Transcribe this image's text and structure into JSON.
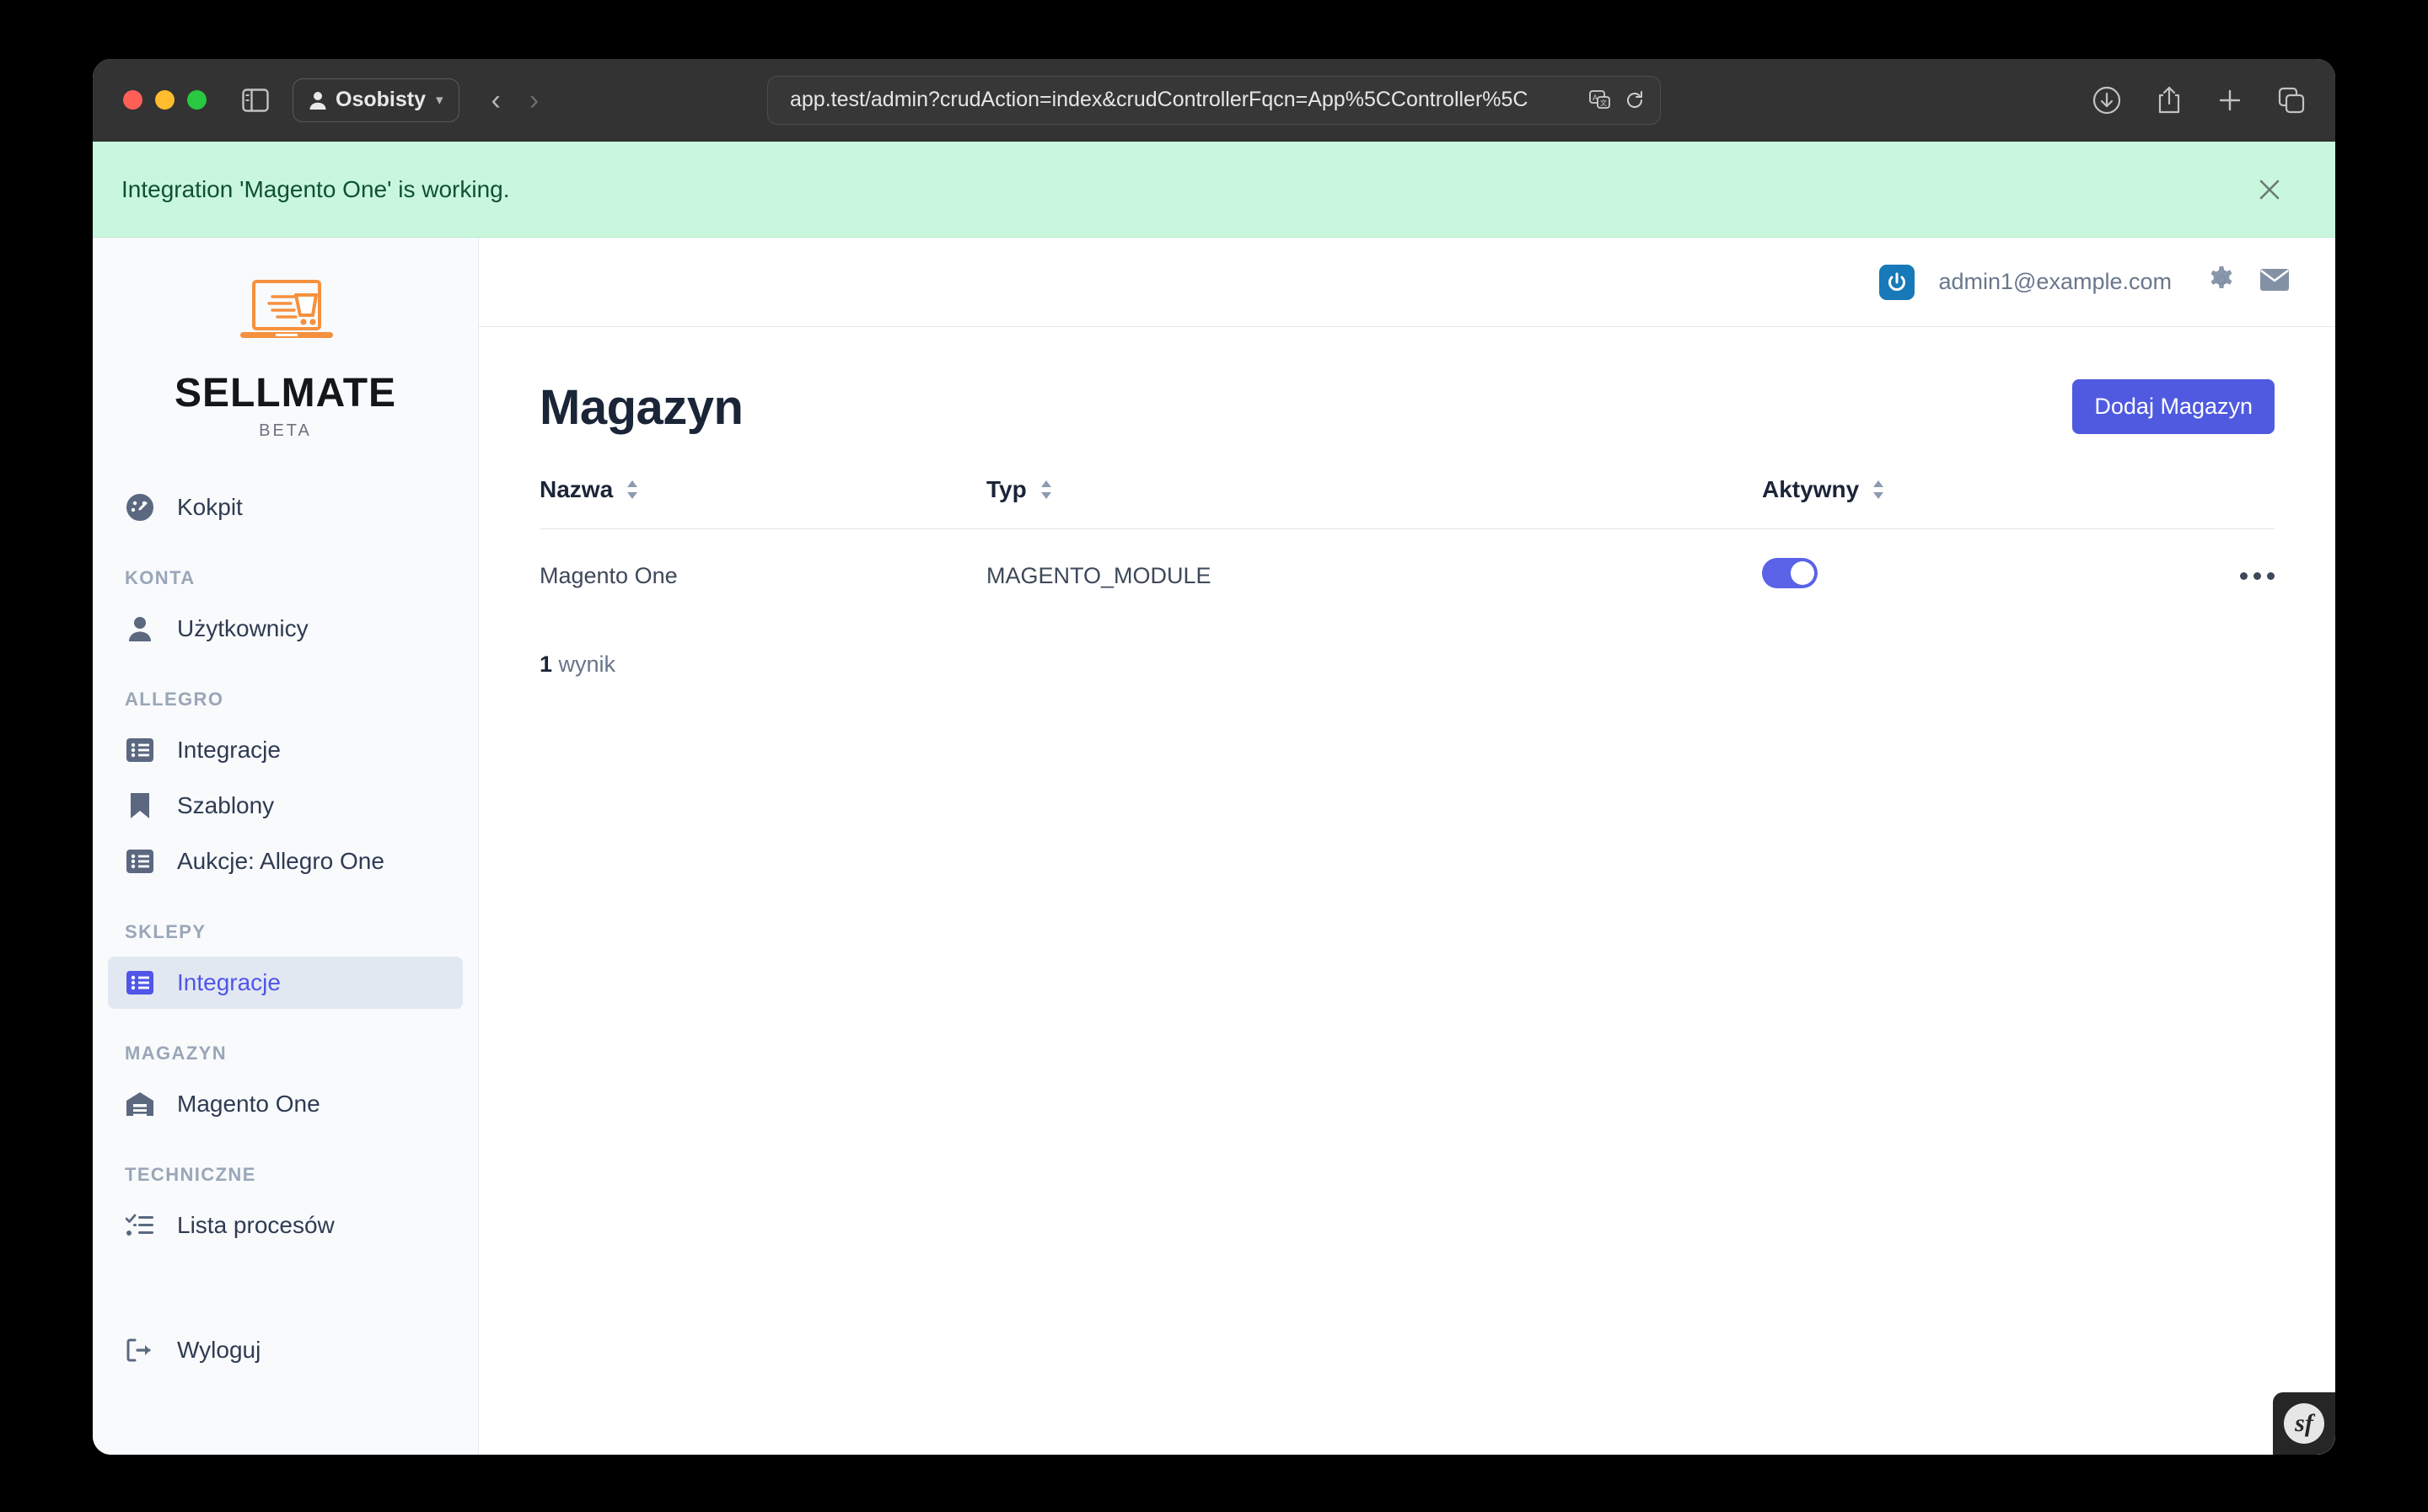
{
  "browser": {
    "profile_label": "Osobisty",
    "url": "app.test/admin?crudAction=index&crudControllerFqcn=App%5CController%5C",
    "back_label": "‹",
    "forward_label": "›",
    "icons": {
      "sidebar": "sidebar-toggle-icon",
      "person": "person-icon",
      "translate": "translate-icon",
      "reload": "reload-icon",
      "download": "download-icon",
      "share": "share-icon",
      "new_tab": "plus-icon",
      "tabs": "tab-overview-icon"
    }
  },
  "banner": {
    "message": "Integration 'Magento One' is working.",
    "close_label": "×",
    "bg_color": "#c9f7dd",
    "text_color": "#0f5132"
  },
  "sidebar": {
    "logo": {
      "word": "SELLMATE",
      "tag": "BETA",
      "accent_color": "#f5913e"
    },
    "items": [
      {
        "label": "Kokpit",
        "icon": "dashboard-icon",
        "active": false
      },
      {
        "label": "Użytkownicy",
        "icon": "user-icon",
        "active": false
      },
      {
        "label": "Integracje",
        "icon": "list-icon",
        "active": false
      },
      {
        "label": "Szablony",
        "icon": "bookmark-icon",
        "active": false
      },
      {
        "label": "Aukcje: Allegro One",
        "icon": "list-icon",
        "active": false
      },
      {
        "label": "Integracje",
        "icon": "list-icon",
        "active": true
      },
      {
        "label": "Magento One",
        "icon": "warehouse-icon",
        "active": false
      },
      {
        "label": "Lista procesów",
        "icon": "checklist-icon",
        "active": false
      },
      {
        "label": "Wyloguj",
        "icon": "logout-icon",
        "active": false
      }
    ],
    "sections": {
      "konta": "KONTA",
      "allegro": "ALLEGRO",
      "sklepy": "SKLEPY",
      "magazyn": "MAGAZYN",
      "techniczne": "TECHNICZNE"
    },
    "active_color": "#4f56e8"
  },
  "topbar": {
    "user_email": "admin1@example.com",
    "power_icon": "power-icon",
    "gear_icon": "gear-icon",
    "mail_icon": "envelope-icon"
  },
  "main": {
    "title": "Magazyn",
    "add_button": "Dodaj Magazyn",
    "accent_color": "#4f5ae0",
    "table": {
      "columns": [
        "Nazwa",
        "Typ",
        "Aktywny"
      ],
      "rows": [
        {
          "nazwa": "Magento One",
          "typ": "MAGENTO_MODULE",
          "aktywny": true
        }
      ]
    },
    "result_count_number": "1",
    "result_count_label": " wynik"
  },
  "footer": {
    "symfony_badge": "sf"
  }
}
